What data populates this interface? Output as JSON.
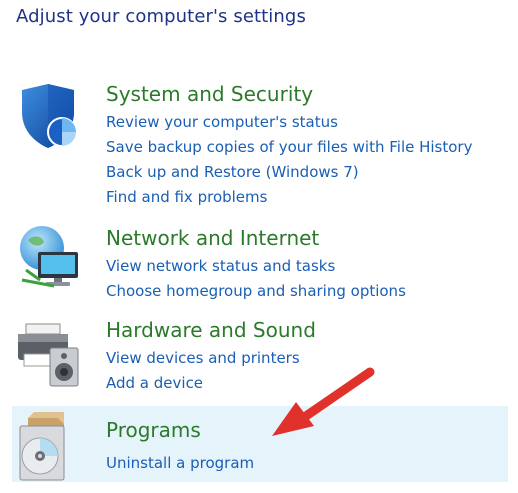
{
  "page": {
    "title": "Adjust your computer's settings"
  },
  "categories": [
    {
      "title": "System and Security",
      "icon": "shield-icon",
      "links": [
        "Review your computer's status",
        "Save backup copies of your files with File History",
        "Back up and Restore (Windows 7)",
        "Find and fix problems"
      ]
    },
    {
      "title": "Network and Internet",
      "icon": "network-globe-icon",
      "links": [
        "View network status and tasks",
        "Choose homegroup and sharing options"
      ]
    },
    {
      "title": "Hardware and Sound",
      "icon": "printer-speaker-icon",
      "links": [
        "View devices and printers",
        "Add a device"
      ]
    },
    {
      "title": "Programs",
      "icon": "programs-disc-icon",
      "links": [
        "Uninstall a program"
      ]
    }
  ],
  "annotation": {
    "icon": "red-arrow-icon",
    "color": "#e0322b"
  },
  "colors": {
    "title": "#1e3287",
    "category_title": "#2b7a2b",
    "link": "#1a5fb4",
    "highlight": "#e5f3fb"
  }
}
